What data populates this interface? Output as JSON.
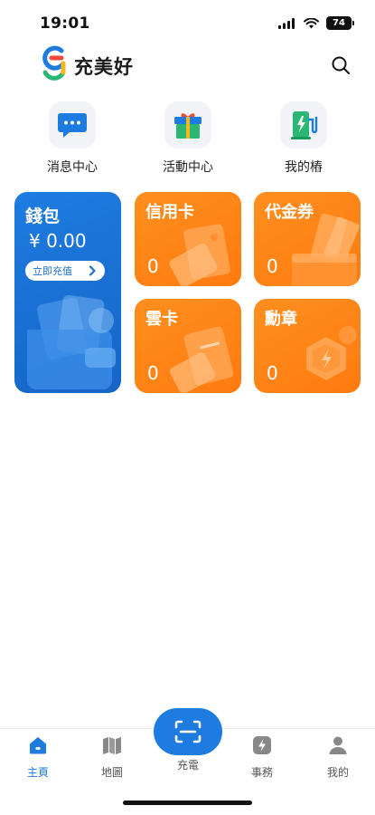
{
  "status_bar": {
    "time": "19:01",
    "battery": "74"
  },
  "header": {
    "brand": "充美好"
  },
  "quick_actions": [
    {
      "label": "消息中心",
      "icon": "message-icon"
    },
    {
      "label": "活動中心",
      "icon": "gift-icon"
    },
    {
      "label": "我的樁",
      "icon": "charging-pile-icon"
    }
  ],
  "wallet": {
    "title": "錢包",
    "amount": "¥ 0.00",
    "topup_label": "立即充值"
  },
  "cards": {
    "credit_card": {
      "title": "信用卡",
      "value": "0"
    },
    "voucher": {
      "title": "代金券",
      "value": "0"
    },
    "cloud_card": {
      "title": "雲卡",
      "value": "0"
    },
    "badge": {
      "title": "勳章",
      "value": "0"
    }
  },
  "tabs": [
    {
      "label": "主頁",
      "icon": "home-icon",
      "active": true
    },
    {
      "label": "地圖",
      "icon": "map-icon",
      "active": false
    },
    {
      "label": "充電",
      "icon": "scan-icon",
      "active": false
    },
    {
      "label": "事務",
      "icon": "bolt-icon",
      "active": false
    },
    {
      "label": "我的",
      "icon": "user-icon",
      "active": false
    }
  ],
  "colors": {
    "primary": "#1e7ce0",
    "orange": "#ff7a0f",
    "green": "#2bb673"
  }
}
